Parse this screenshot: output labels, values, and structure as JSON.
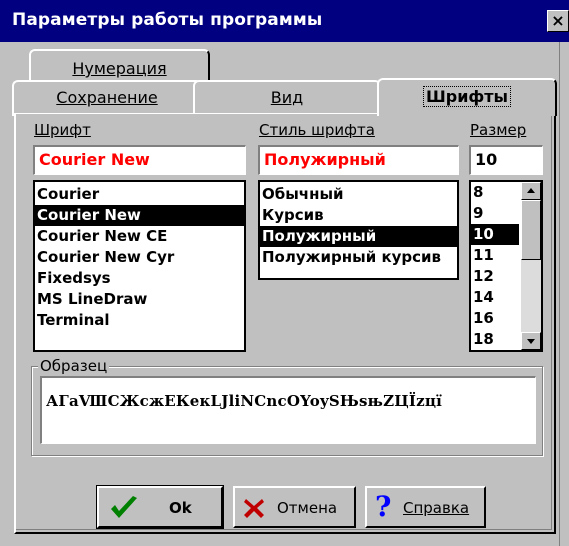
{
  "window": {
    "title": "Параметры работы программы",
    "close_glyph": "×"
  },
  "tabs": {
    "numbering": "Нумерация",
    "saving": "Сохранение",
    "view": "Вид",
    "fonts": "Шрифты",
    "active": "Шрифты"
  },
  "fonts_page": {
    "font_label": "Шрифт",
    "style_label": "Стиль шрифта",
    "size_label": "Размер",
    "font_value": "Courier New",
    "style_value": "Полужирный",
    "size_value": "10",
    "font_list": [
      "Courier",
      "Courier New",
      "Courier New CE",
      "Courier New Cyr",
      "Fixedsys",
      "MS LineDraw",
      "Terminal"
    ],
    "font_selected": "Courier New",
    "style_list": [
      "Обычный",
      "Курсив",
      "Полужирный",
      "Полужирный курсив"
    ],
    "style_selected": "Полужирный",
    "size_list": [
      "8",
      "9",
      "10",
      "11",
      "12",
      "14",
      "16",
      "18"
    ],
    "size_selected": "10",
    "sample_label": "Образец",
    "sample_text": "АГаⅧСЖсжЕКекLJliNСnсOYoySЊѕњZЦЇzцї"
  },
  "buttons": {
    "ok": "Ok",
    "cancel": "Отмена",
    "help": "Справка"
  },
  "colors": {
    "titlebar": "#000080",
    "face": "#c0c0c0",
    "field_value_text": "#ff0000",
    "ok_icon": "#008000",
    "cancel_icon": "#c00000",
    "help_icon": "#0000ff"
  },
  "icons": {
    "ok": "checkmark-icon",
    "cancel": "x-icon",
    "help": "question-icon"
  }
}
